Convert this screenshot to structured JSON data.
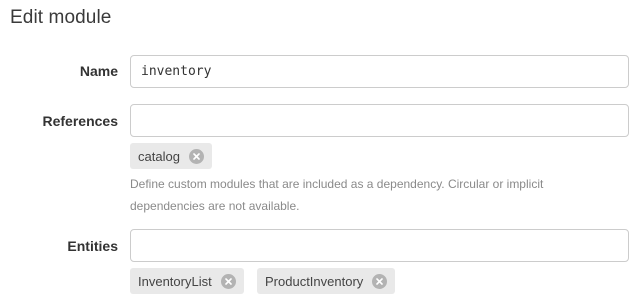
{
  "page": {
    "title": "Edit module"
  },
  "form": {
    "name": {
      "label": "Name",
      "value": "inventory"
    },
    "references": {
      "label": "References",
      "value": "",
      "tags": [
        {
          "label": "catalog",
          "remove_icon": "close-circle-icon"
        }
      ],
      "help": "Define custom modules that are included as a dependency. Circular or implicit dependencies are not available."
    },
    "entities": {
      "label": "Entities",
      "value": "",
      "tags": [
        {
          "label": "InventoryList",
          "remove_icon": "close-circle-icon"
        },
        {
          "label": "ProductInventory",
          "remove_icon": "close-circle-icon"
        }
      ]
    }
  },
  "colors": {
    "tag_background": "#e9e9e9",
    "tag_remove": "#b3b3b3",
    "input_border": "#cccccc",
    "help_text": "#8a8a8a"
  }
}
